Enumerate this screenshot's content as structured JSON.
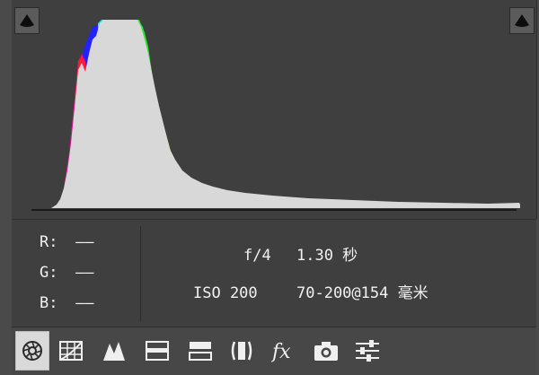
{
  "histogram": {
    "shadow_clip_icon": "triangle-up-warning-icon",
    "highlight_clip_icon": "triangle-up-warning-icon"
  },
  "info": {
    "r_label": "R:",
    "g_label": "G:",
    "b_label": "B:",
    "r_value": "——",
    "g_value": "——",
    "b_value": "——",
    "aperture": "f/4",
    "shutter": "1.30 秒",
    "iso": "ISO 200",
    "lens": "70-200@154 毫米"
  },
  "toolbar": {
    "active": "basic",
    "tools": [
      {
        "id": "basic",
        "icon": "aperture-icon"
      },
      {
        "id": "tone-curve",
        "icon": "grid-curve-icon"
      },
      {
        "id": "detail",
        "icon": "mountain-icon"
      },
      {
        "id": "hsl",
        "icon": "hsl-bars-icon"
      },
      {
        "id": "split-toning",
        "icon": "split-toning-icon"
      },
      {
        "id": "lens-corrections",
        "icon": "lens-icon"
      },
      {
        "id": "effects",
        "icon": "fx-icon"
      },
      {
        "id": "camera-calibration",
        "icon": "camera-icon"
      },
      {
        "id": "presets",
        "icon": "sliders-icon"
      }
    ]
  }
}
